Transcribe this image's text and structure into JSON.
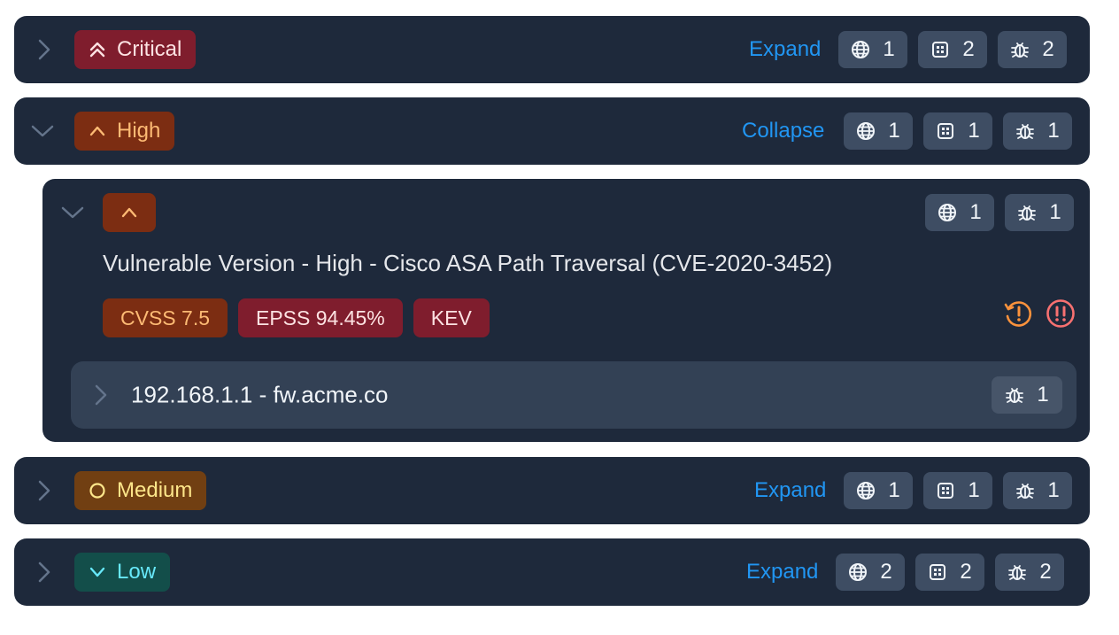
{
  "groups": [
    {
      "severity": "Critical",
      "toggle": "Expand",
      "counts": {
        "assets": "1",
        "components": "2",
        "vulns": "2"
      }
    },
    {
      "severity": "High",
      "toggle": "Collapse",
      "counts": {
        "assets": "1",
        "components": "1",
        "vulns": "1"
      }
    },
    {
      "severity": "Medium",
      "toggle": "Expand",
      "counts": {
        "assets": "1",
        "components": "1",
        "vulns": "1"
      }
    },
    {
      "severity": "Low",
      "toggle": "Expand",
      "counts": {
        "assets": "2",
        "components": "2",
        "vulns": "2"
      }
    }
  ],
  "finding": {
    "title": "Vulnerable Version - High - Cisco ASA Path Traversal (CVE-2020-3452)",
    "tags": {
      "cvss": "CVSS 7.5",
      "epss": "EPSS 94.45%",
      "kev": "KEV"
    },
    "counts": {
      "assets": "1",
      "vulns": "1"
    },
    "status_icons": [
      "history-warning-icon",
      "exclamation-alert-icon"
    ],
    "host": {
      "label": "192.168.1.1 - fw.acme.co",
      "vulns": "1"
    }
  },
  "colors": {
    "panel": "#1e293b",
    "chip": "#3e4d63",
    "link": "#2196f3",
    "critical_bg": "#7f1d2d",
    "critical_fg": "#fde2e2",
    "high_bg": "#7c2d12",
    "high_fg": "#fdba74",
    "medium_bg": "#713f12",
    "medium_fg": "#fde68a",
    "low_bg": "#134e4a",
    "low_fg": "#67e8f9",
    "warning": "#fb923c",
    "danger": "#f87171"
  }
}
